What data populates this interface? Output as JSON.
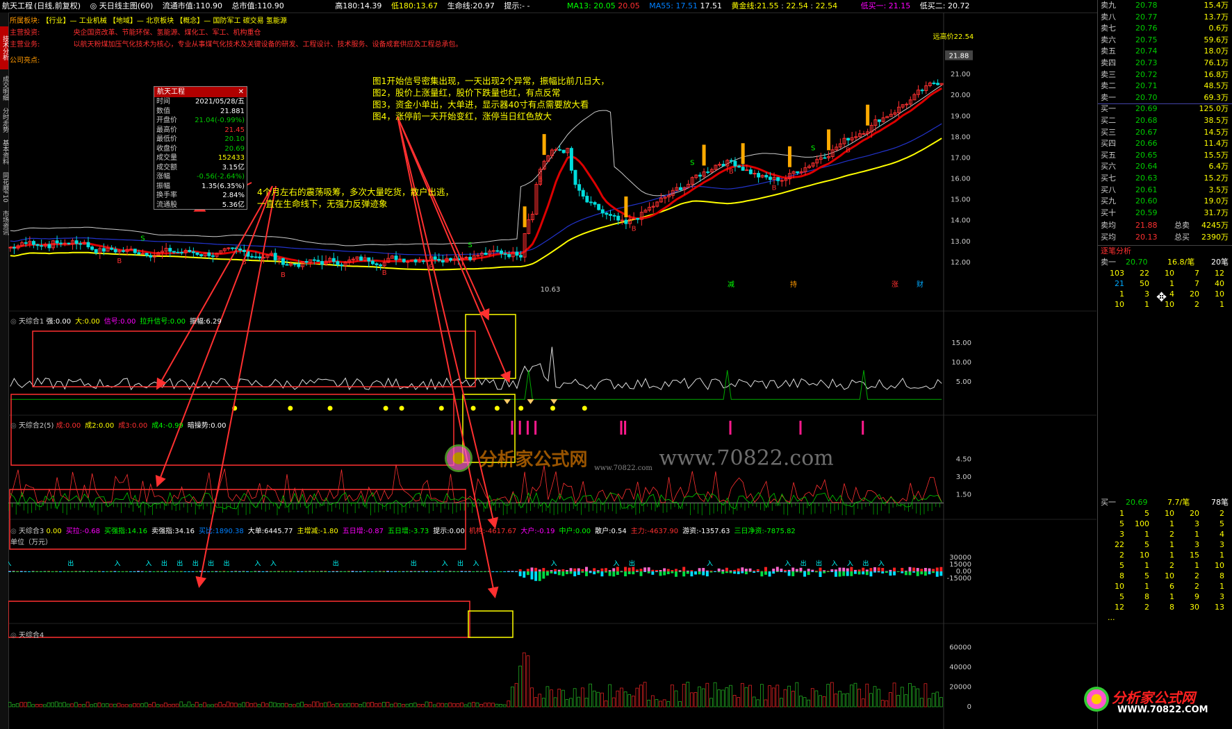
{
  "header": {
    "stock_name": "航天工程",
    "period": "(日线,前复权)",
    "indicator": "天日线主图(60)",
    "float_mv_label": "流通市值:",
    "float_mv": "110.90",
    "total_mv_label": "总市值:",
    "total_mv": "110.90",
    "high180_label": "高180:",
    "high180": "14.39",
    "low180_label": "低180:",
    "low180": "13.67",
    "life_label": "生命线:",
    "life": "20.97",
    "hint_label": "提示:",
    "hint": "- -",
    "ma13_label": "MA13:",
    "ma13_a": "20.05",
    "ma13_b": "20.05",
    "ma55_label": "MA55:",
    "ma55_a": "17.51",
    "ma55_b": "17.51",
    "gold_label": "黄金线:",
    "gold_a": "21.55",
    "gold_b": "22.54",
    "gold_c": "22.54",
    "buy1_label": "低买一:",
    "buy1": "21.15",
    "buy2_label": "低买二:",
    "buy2": "20.72"
  },
  "info_rows": [
    {
      "label": "所属板块:",
      "text": "【行业】— 工业机械    【地域】— 北京板块    【概念】— 国防军工 碳交易 氢能源"
    },
    {
      "label": "主营投资:",
      "text": "央企国资改革、节能环保、氢能源、煤化工、军工、机构重仓"
    },
    {
      "label": "主营业务:",
      "text": "以航天粉煤加压气化技术为核心，专业从事煤气化技术及关键设备的研发、工程设计、技术服务、设备成套供应及工程总承包。"
    },
    {
      "label": "公司亮点:",
      "text": ""
    }
  ],
  "left_tabs": [
    "技术分析",
    "成交明细",
    "分时走势",
    "基本资料",
    "同花顺F10",
    "市场资讯"
  ],
  "popup": {
    "title": "航天工程",
    "rows": [
      {
        "k": "时间",
        "v": "2021/05/28/五",
        "c": "#ffffff"
      },
      {
        "k": "数值",
        "v": "21.881",
        "c": "#ffffff"
      },
      {
        "k": "开盘价",
        "v": "21.04(-0.99%)",
        "c": "#00cc00"
      },
      {
        "k": "最高价",
        "v": "21.45",
        "c": "#ff3030"
      },
      {
        "k": "最低价",
        "v": "20.10",
        "c": "#00cc00"
      },
      {
        "k": "收盘价",
        "v": "20.69",
        "c": "#00cc00"
      },
      {
        "k": "成交量",
        "v": "152433",
        "c": "#ffff00"
      },
      {
        "k": "成交额",
        "v": "3.15亿",
        "c": "#ffffff"
      },
      {
        "k": "涨幅",
        "v": "-0.56(-2.64%)",
        "c": "#00cc00"
      },
      {
        "k": "振幅",
        "v": "1.35(6.35%)",
        "c": "#ffffff"
      },
      {
        "k": "换手率",
        "v": "2.84%",
        "c": "#ffffff"
      },
      {
        "k": "流通股",
        "v": "5.36亿",
        "c": "#ffffff"
      }
    ]
  },
  "notes": {
    "note1": [
      "图1开始信号密集出现，一天出现2个异常，振幅比前几日大，",
      "图2，股价上涨量红，股价下跌量也红，有点反常",
      "图3，资金小单出，大单进，显示器40寸有点需要放大看",
      "图4，涨停前一天开始变红，涨停当日红色放大"
    ],
    "note2": [
      "4个月左右的震荡吸筹，多次大量吃货，散户出逃，",
      "一直在生命线下，无强力反弹迹象"
    ]
  },
  "main_chart": {
    "recent_high_label": "远高价22.54",
    "price_axis": [
      "21.88",
      "21.00",
      "20.00",
      "19.00",
      "18.00",
      "17.00",
      "16.00",
      "15.00",
      "14.00",
      "13.00",
      "12.00"
    ],
    "current_price_tag": "21.88",
    "low_label": "10.63",
    "tags": [
      "减",
      "持",
      "涨",
      "财"
    ]
  },
  "indicators": {
    "ind1": {
      "title": "天综合1",
      "items": [
        {
          "k": "强:",
          "v": "0.00",
          "c": "#ffffff"
        },
        {
          "k": "大:",
          "v": "0.00",
          "c": "#ffff00"
        },
        {
          "k": "信号:",
          "v": "0.00",
          "c": "#ff00ff"
        },
        {
          "k": "拉升信号:",
          "v": "0.00",
          "c": "#00ff00"
        },
        {
          "k": "振幅:",
          "v": "6.29",
          "c": "#ffffff"
        }
      ],
      "axis": [
        "15.00",
        "10.00",
        "5.00"
      ]
    },
    "ind2": {
      "title": "天综合2(5)",
      "items": [
        {
          "k": "成:",
          "v": "0.00",
          "c": "#ff3030"
        },
        {
          "k": "成2:",
          "v": "0.00",
          "c": "#ffff00"
        },
        {
          "k": "成3:",
          "v": "0.00",
          "c": "#ff3030"
        },
        {
          "k": "成4:",
          "v": "-0.99",
          "c": "#00ff00"
        },
        {
          "k": "暗操势:",
          "v": "0.00",
          "c": "#ffffff"
        }
      ],
      "axis": [
        "4.50",
        "3.00",
        "1.50"
      ]
    },
    "ind3": {
      "title": "天综合3",
      "unit": "单位（万元）",
      "items": [
        {
          "k": "",
          "v": "0.00",
          "c": "#ffff00"
        },
        {
          "k": "买拉:",
          "v": "-0.68",
          "c": "#ff00ff"
        },
        {
          "k": "买强指:",
          "v": "14.16",
          "c": "#00ff00"
        },
        {
          "k": "卖强指:",
          "v": "34.16",
          "c": "#ffffff"
        },
        {
          "k": "买比:",
          "v": "1890.38",
          "c": "#0080ff"
        },
        {
          "k": "大单:",
          "v": "6445.77",
          "c": "#ffffff"
        },
        {
          "k": "主增减:",
          "v": "-1.80",
          "c": "#ffff00"
        },
        {
          "k": "五日增:",
          "v": "-0.87",
          "c": "#ff00ff"
        },
        {
          "k": "五日增:",
          "v": "-3.73",
          "c": "#00ff00"
        },
        {
          "k": "提示:",
          "v": "0.00",
          "c": "#ffffff"
        },
        {
          "k": "机构:",
          "v": "-4617.67",
          "c": "#ff3030"
        },
        {
          "k": "大户:",
          "v": "-0.19",
          "c": "#ff00ff"
        },
        {
          "k": "中户:",
          "v": "0.00",
          "c": "#00ff00"
        },
        {
          "k": "散户:",
          "v": "0.54",
          "c": "#ffffff"
        },
        {
          "k": "主力:",
          "v": "-4637.90",
          "c": "#ff3030"
        },
        {
          "k": "游资:",
          "v": "-1357.63",
          "c": "#ffffff"
        },
        {
          "k": "三日净资:",
          "v": "-7875.82",
          "c": "#00ff00"
        }
      ],
      "axis": [
        "30000",
        "15000",
        "0.00",
        "-15000"
      ]
    },
    "ind4": {
      "title": "天综合4",
      "axis": [
        "60000",
        "40000",
        "20000",
        "0"
      ]
    }
  },
  "orderbook": {
    "asks": [
      {
        "label": "卖九",
        "price": "20.78",
        "vol": "15.4万"
      },
      {
        "label": "卖八",
        "price": "20.77",
        "vol": "13.7万"
      },
      {
        "label": "卖七",
        "price": "20.76",
        "vol": "0.6万"
      },
      {
        "label": "卖六",
        "price": "20.75",
        "vol": "59.6万"
      },
      {
        "label": "卖五",
        "price": "20.74",
        "vol": "18.0万"
      },
      {
        "label": "卖四",
        "price": "20.73",
        "vol": "76.1万"
      },
      {
        "label": "卖三",
        "price": "20.72",
        "vol": "16.8万"
      },
      {
        "label": "卖二",
        "price": "20.71",
        "vol": "48.5万"
      },
      {
        "label": "卖一",
        "price": "20.70",
        "vol": "69.3万"
      }
    ],
    "bids": [
      {
        "label": "买一",
        "price": "20.69",
        "vol": "125.0万"
      },
      {
        "label": "买二",
        "price": "20.68",
        "vol": "38.5万"
      },
      {
        "label": "买三",
        "price": "20.67",
        "vol": "14.5万"
      },
      {
        "label": "买四",
        "price": "20.66",
        "vol": "11.4万"
      },
      {
        "label": "买五",
        "price": "20.65",
        "vol": "15.5万"
      },
      {
        "label": "买六",
        "price": "20.64",
        "vol": "6.4万"
      },
      {
        "label": "买七",
        "price": "20.63",
        "vol": "15.2万"
      },
      {
        "label": "买八",
        "price": "20.61",
        "vol": "3.5万"
      },
      {
        "label": "买九",
        "price": "20.60",
        "vol": "19.0万"
      },
      {
        "label": "买十",
        "price": "20.59",
        "vol": "31.7万"
      }
    ],
    "avg_sell_label": "卖均",
    "avg_sell": "21.88",
    "total_sell_label": "总卖",
    "total_sell": "4245万",
    "avg_buy_label": "买均",
    "avg_buy": "20.13",
    "total_buy_label": "总买",
    "total_buy": "2390万",
    "tick_title": "逐笔分析",
    "sell1_label": "卖一",
    "sell1_price": "20.70",
    "sell1_per": "16.8/笔",
    "sell1_count": "20笔",
    "sell_ticks": [
      [
        "103",
        "22",
        "10",
        "7",
        "12"
      ],
      [
        "21",
        "50",
        "1",
        "7",
        "40"
      ],
      [
        "1",
        "3",
        "4",
        "20",
        "10"
      ],
      [
        "10",
        "1",
        "10",
        "2",
        "1"
      ]
    ],
    "buy1_label": "买一",
    "buy1_price": "20.69",
    "buy1_per": "7.7/笔",
    "buy1_count": "78笔",
    "buy_ticks": [
      [
        "1",
        "5",
        "10",
        "20",
        "2"
      ],
      [
        "5",
        "100",
        "1",
        "3",
        "5"
      ],
      [
        "3",
        "1",
        "2",
        "1",
        "4"
      ],
      [
        "22",
        "5",
        "1",
        "3",
        "3"
      ],
      [
        "2",
        "10",
        "1",
        "15",
        "1"
      ],
      [
        "5",
        "1",
        "2",
        "1",
        "10"
      ],
      [
        "8",
        "5",
        "10",
        "2",
        "8"
      ],
      [
        "10",
        "1",
        "6",
        "2",
        "1"
      ],
      [
        "5",
        "8",
        "1",
        "9",
        "3"
      ],
      [
        "12",
        "2",
        "8",
        "30",
        "13"
      ]
    ],
    "more": "..."
  },
  "watermark": "www.70822.com",
  "logo_text": "分析家公式网",
  "logo_url": "WWW.70822.COM",
  "logo_text_small": "分析家公式网",
  "logo_url_small": "www.70822.com"
}
